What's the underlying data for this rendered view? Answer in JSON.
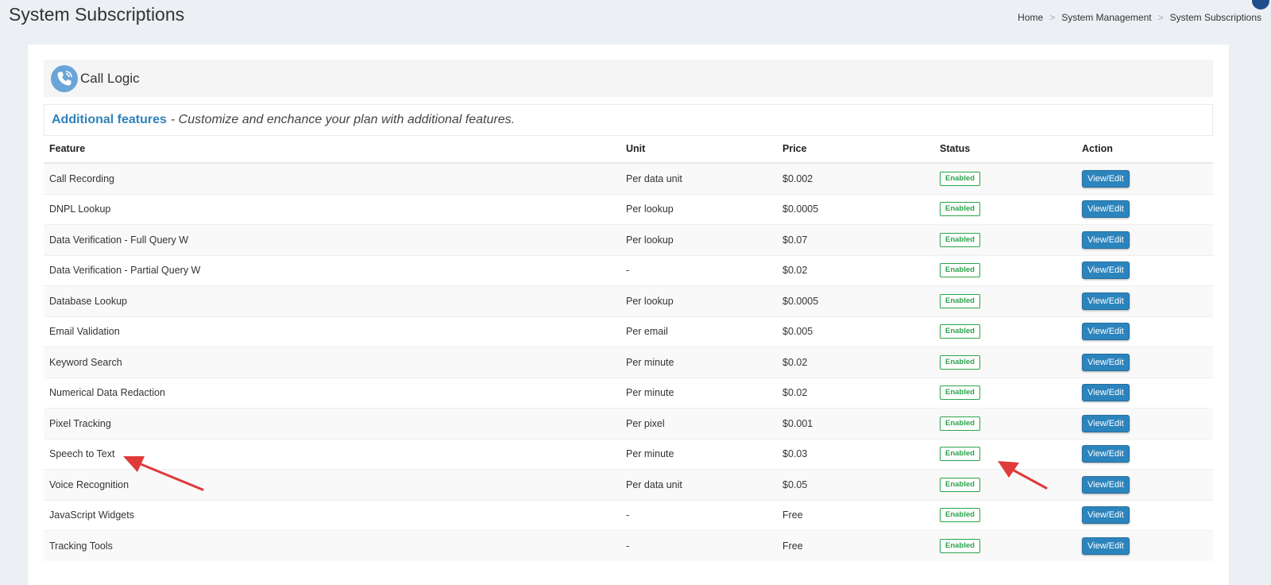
{
  "header": {
    "title": "System Subscriptions",
    "breadcrumb": [
      "Home",
      "System Management",
      "System Subscriptions"
    ],
    "separator": ">"
  },
  "product": {
    "name": "Call Logic",
    "logo_icon": "phone-icon",
    "logo_color": "#6aa5d9"
  },
  "features_section": {
    "title": "Additional features",
    "description": "- Customize and enchance your plan with additional features."
  },
  "table": {
    "columns": [
      "Feature",
      "Unit",
      "Price",
      "Status",
      "Action"
    ],
    "rows": [
      {
        "feature": "Call Recording",
        "unit": "Per data unit",
        "price": "$0.002",
        "status": "Enabled",
        "action": "View/Edit"
      },
      {
        "feature": "DNPL Lookup",
        "unit": "Per lookup",
        "price": "$0.0005",
        "status": "Enabled",
        "action": "View/Edit"
      },
      {
        "feature": "Data Verification - Full Query W",
        "unit": "Per lookup",
        "price": "$0.07",
        "status": "Enabled",
        "action": "View/Edit"
      },
      {
        "feature": "Data Verification - Partial Query W",
        "unit": "-",
        "price": "$0.02",
        "status": "Enabled",
        "action": "View/Edit"
      },
      {
        "feature": "Database Lookup",
        "unit": "Per lookup",
        "price": "$0.0005",
        "status": "Enabled",
        "action": "View/Edit"
      },
      {
        "feature": "Email Validation",
        "unit": "Per email",
        "price": "$0.005",
        "status": "Enabled",
        "action": "View/Edit"
      },
      {
        "feature": "Keyword Search",
        "unit": "Per minute",
        "price": "$0.02",
        "status": "Enabled",
        "action": "View/Edit"
      },
      {
        "feature": "Numerical Data Redaction",
        "unit": "Per minute",
        "price": "$0.02",
        "status": "Enabled",
        "action": "View/Edit"
      },
      {
        "feature": "Pixel Tracking",
        "unit": "Per pixel",
        "price": "$0.001",
        "status": "Enabled",
        "action": "View/Edit"
      },
      {
        "feature": "Speech to Text",
        "unit": "Per minute",
        "price": "$0.03",
        "status": "Enabled",
        "action": "View/Edit"
      },
      {
        "feature": "Voice Recognition",
        "unit": "Per data unit",
        "price": "$0.05",
        "status": "Enabled",
        "action": "View/Edit"
      },
      {
        "feature": "JavaScript Widgets",
        "unit": "-",
        "price": "Free",
        "status": "Enabled",
        "action": "View/Edit"
      },
      {
        "feature": "Tracking Tools",
        "unit": "-",
        "price": "Free",
        "status": "Enabled",
        "action": "View/Edit"
      }
    ]
  },
  "colors": {
    "accent": "#2c84bd",
    "status_enabled": "#2ba34a",
    "annotation_arrow": "#e03a3a"
  }
}
